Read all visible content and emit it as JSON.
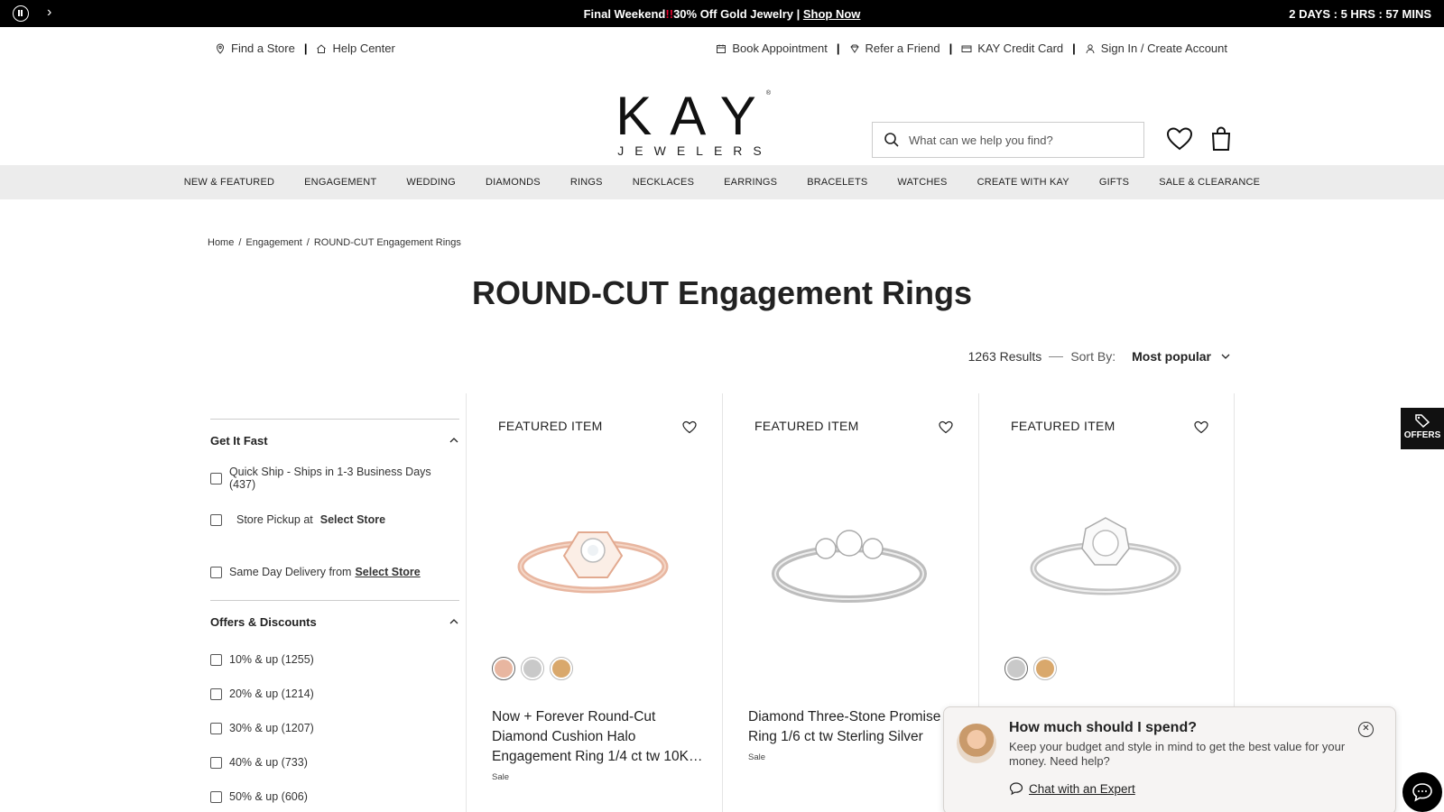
{
  "promo": {
    "message_pre": "Final Weekend",
    "message_bang": "!!",
    "message_post": "30% Off Gold Jewelry | ",
    "link": "Shop Now",
    "timer": "2 DAYS : 5 HRS : 57 MINS"
  },
  "utility": {
    "find_store": "Find a Store",
    "help_center": "Help Center",
    "book": "Book Appointment",
    "refer": "Refer a Friend",
    "credit": "KAY Credit Card",
    "signin": "Sign In / Create Account"
  },
  "logo": {
    "brand": "KAY",
    "sub": "JEWELERS",
    "reg": "®"
  },
  "search": {
    "placeholder": "What can we help you find?"
  },
  "nav": [
    "NEW & FEATURED",
    "ENGAGEMENT",
    "WEDDING",
    "DIAMONDS",
    "RINGS",
    "NECKLACES",
    "EARRINGS",
    "BRACELETS",
    "WATCHES",
    "CREATE WITH KAY",
    "GIFTS",
    "SALE & CLEARANCE"
  ],
  "breadcrumb": {
    "home": "Home",
    "engagement": "Engagement",
    "current": "ROUND-CUT Engagement Rings"
  },
  "title": "ROUND-CUT Engagement Rings",
  "results": {
    "count": "1263 Results",
    "sort_label": "Sort By:",
    "sort_value": "Most popular"
  },
  "filters": {
    "get_it_fast": {
      "title": "Get It Fast",
      "quick_ship": "Quick Ship - Ships in 1-3 Business Days (437)",
      "store_pickup": "Store Pickup at",
      "select_store": "Select Store",
      "same_day": "Same Day Delivery from",
      "select_store_2": "Select Store"
    },
    "offers": {
      "title": "Offers & Discounts",
      "items": [
        "10% & up (1255)",
        "20% & up (1214)",
        "30% & up (1207)",
        "40% & up (733)",
        "50% & up (606)"
      ]
    }
  },
  "products": [
    {
      "badge": "FEATURED ITEM",
      "name": "Now + Forever Round-Cut Diamond Cushion Halo Engagement Ring 1/4 ct tw 10K…",
      "tag": "Sale"
    },
    {
      "badge": "FEATURED ITEM",
      "name": "Diamond Three-Stone Promise Ring 1/6 ct tw Sterling Silver",
      "tag": "Sale"
    },
    {
      "badge": "FEATURED ITEM",
      "name": "",
      "tag": ""
    }
  ],
  "offers_tab": "OFFERS",
  "chat": {
    "question": "How much should I spend?",
    "desc": "Keep your budget and style in mind to get the best value for your money. Need help?",
    "link": "Chat with an Expert"
  },
  "colors": {
    "rose": "#e8b6a0",
    "silver": "#c9c9c9",
    "gold": "#d9a86c"
  }
}
